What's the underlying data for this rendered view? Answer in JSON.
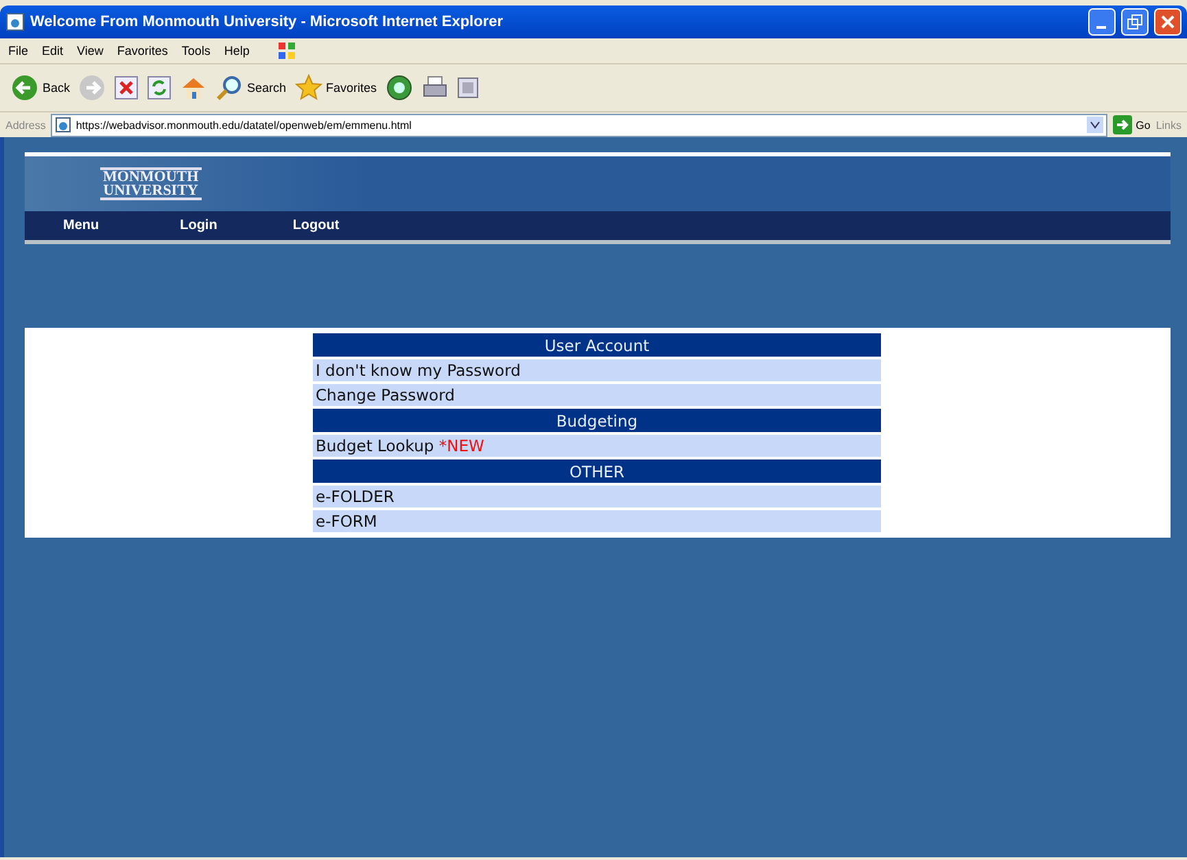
{
  "window": {
    "title": "Welcome From Monmouth University - Microsoft Internet Explorer"
  },
  "menu_bar": [
    "File",
    "Edit",
    "View",
    "Favorites",
    "Tools",
    "Help"
  ],
  "toolbar": [
    {
      "kind": "back",
      "label": "Back"
    },
    {
      "kind": "forward"
    },
    {
      "kind": "stop"
    },
    {
      "kind": "refresh"
    },
    {
      "kind": "home"
    },
    {
      "kind": "search",
      "label": "Search"
    },
    {
      "kind": "favorites",
      "label": "Favorites"
    },
    {
      "kind": "media"
    },
    {
      "kind": "print"
    },
    {
      "kind": "extra"
    }
  ],
  "address_bar": {
    "label": "Address",
    "url": "https://webadvisor.monmouth.edu/datatel/openweb/em/emmenu.html",
    "go": "Go",
    "links": "Links"
  },
  "logo": {
    "line_1": "MONMOUTH",
    "line_2": "UNIVERSITY"
  },
  "nav": [
    "Menu",
    "Login",
    "Logout"
  ],
  "sections": [
    {
      "title": "User Account",
      "items": [
        {
          "label": "I don't know my Password"
        },
        {
          "label": "Change Password"
        }
      ]
    },
    {
      "title": "Budgeting",
      "items": [
        {
          "label": "Budget Lookup",
          "badge": "*NEW"
        }
      ]
    },
    {
      "title": "OTHER",
      "items": [
        {
          "label": "e-FOLDER"
        },
        {
          "label": "e-FORM"
        }
      ]
    }
  ]
}
